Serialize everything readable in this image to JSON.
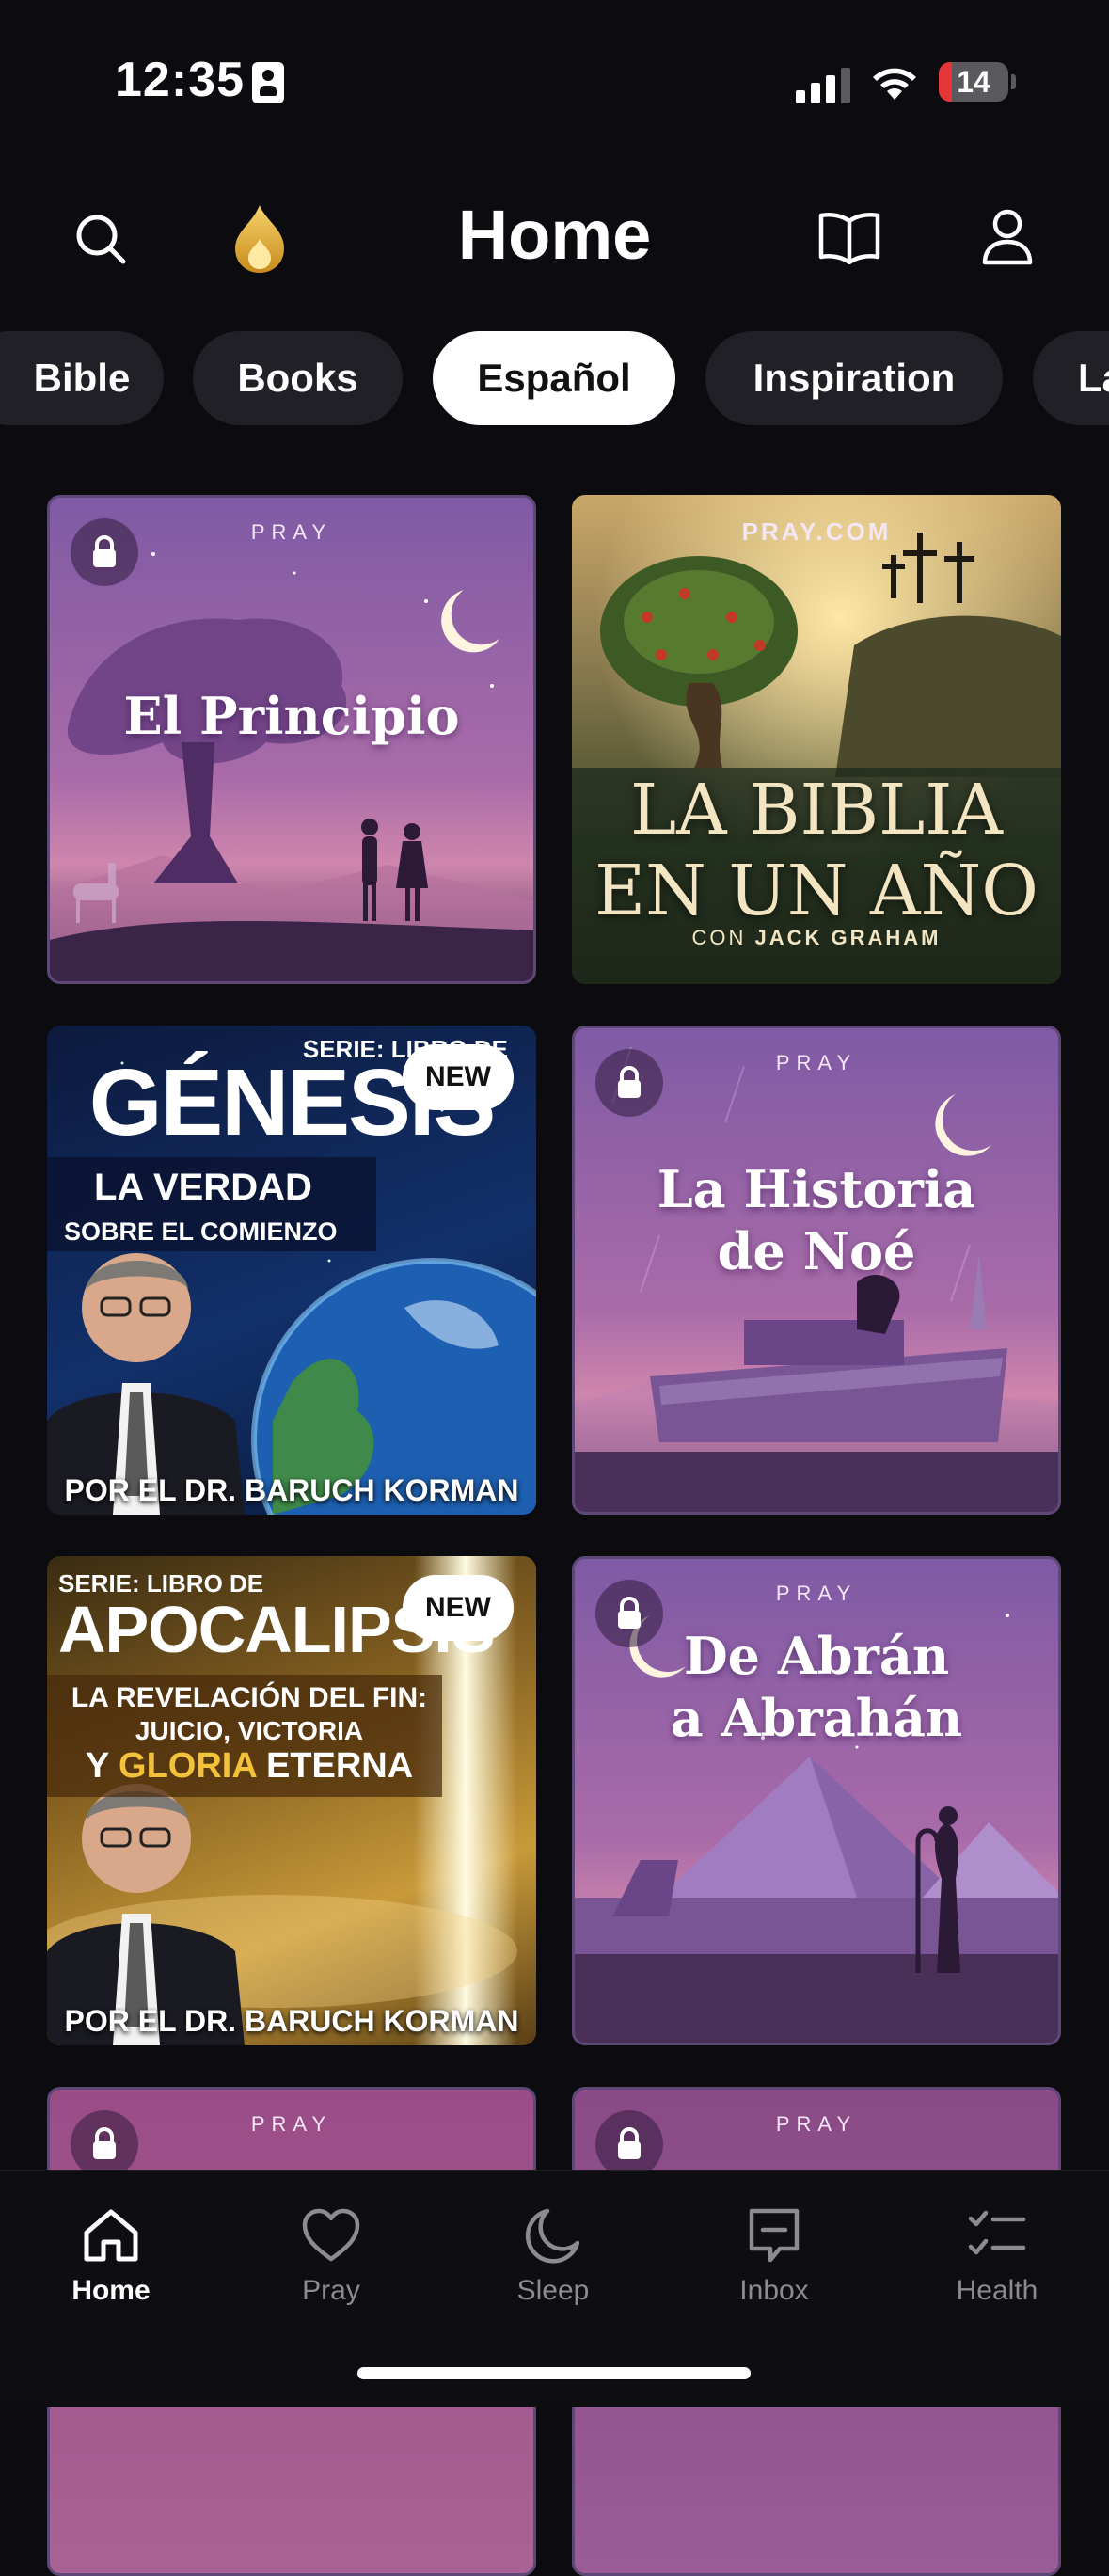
{
  "status_bar": {
    "time": "12:35",
    "battery": "14"
  },
  "header": {
    "title": "Home",
    "icons": [
      "search-icon",
      "flame-icon",
      "book-icon",
      "profile-icon"
    ]
  },
  "tabs": [
    {
      "label": "Bible",
      "active": false
    },
    {
      "label": "Books",
      "active": false
    },
    {
      "label": "Español",
      "active": true
    },
    {
      "label": "Inspiration",
      "active": false
    },
    {
      "label": "La",
      "active": false
    }
  ],
  "cards": [
    {
      "brand": "PRAY",
      "title": "El Principio",
      "locked": true
    },
    {
      "brand": "PRAY.COM",
      "title_line1": "LA BIBLIA",
      "title_line2": "EN UN AÑO",
      "subtitle_prefix": "CON ",
      "subtitle_name": "JACK GRAHAM",
      "locked": false
    },
    {
      "series": "SERIE: LIBRO DE",
      "title": "GÉNESIS",
      "badge": "NEW",
      "line1": "LA VERDAD",
      "line2": "SOBRE EL COMIENZO",
      "author": "POR EL DR. BARUCH KORMAN"
    },
    {
      "brand": "PRAY",
      "title_line1": "La Historia",
      "title_line2": "de Noé",
      "locked": true
    },
    {
      "series": "SERIE: LIBRO DE",
      "title": "APOCALIPSIS",
      "badge": "NEW",
      "line1": "LA REVELACIÓN DEL FIN:",
      "line2": "JUICIO, VICTORIA",
      "line3_a": "Y ",
      "line3_b": "GLORIA",
      "line3_c": " ETERNA",
      "author": "POR EL DR. BARUCH KORMAN"
    },
    {
      "brand": "PRAY",
      "title_line1": "De Abrán",
      "title_line2": "a Abrahán",
      "locked": true
    },
    {
      "brand": "PRAY",
      "locked": true
    },
    {
      "brand": "PRAY",
      "locked": true
    }
  ],
  "bottom_nav": [
    {
      "label": "Home",
      "icon": "home-icon",
      "active": true
    },
    {
      "label": "Pray",
      "icon": "heart-icon",
      "active": false
    },
    {
      "label": "Sleep",
      "icon": "moon-icon",
      "active": false
    },
    {
      "label": "Inbox",
      "icon": "message-icon",
      "active": false
    },
    {
      "label": "Health",
      "icon": "checklist-icon",
      "active": false
    }
  ]
}
